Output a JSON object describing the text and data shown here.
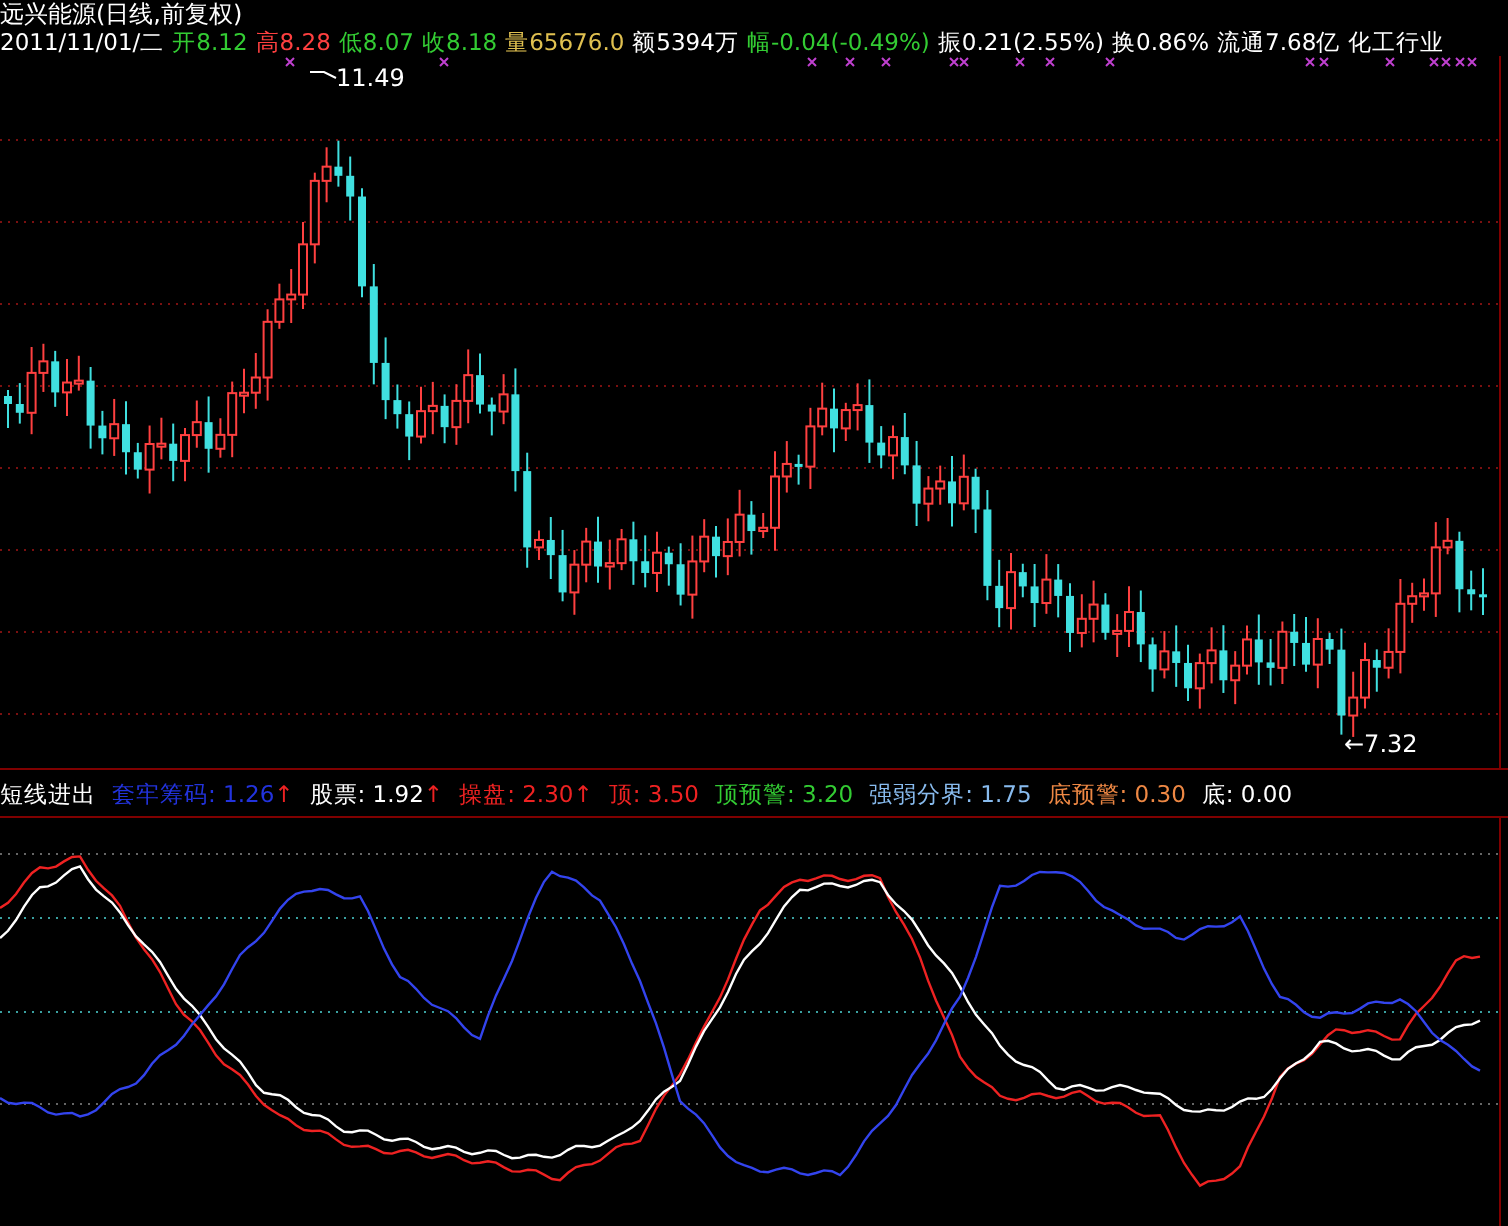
{
  "title": "远兴能源(日线,前复权)",
  "quote": [
    {
      "text": "2011/11/01/二",
      "color": "#ffffff"
    },
    {
      "text": "开8.12",
      "color": "#33cc33"
    },
    {
      "text": "高8.28",
      "color": "#ff4040"
    },
    {
      "text": "低8.07",
      "color": "#33cc33"
    },
    {
      "text": "收8.18",
      "color": "#33cc33"
    },
    {
      "text": "量65676.0",
      "color": "#e0c050"
    },
    {
      "text": "额5394万",
      "color": "#ffffff"
    },
    {
      "text": "幅-0.04(-0.49%)",
      "color": "#33cc33"
    },
    {
      "text": "振0.21(2.55%)",
      "color": "#ffffff"
    },
    {
      "text": "换0.86%",
      "color": "#ffffff"
    },
    {
      "text": "流通7.68亿",
      "color": "#ffffff"
    },
    {
      "text": "化工行业",
      "color": "#ffffff"
    }
  ],
  "main_chart": {
    "high_label": "11.49",
    "low_label": "←7.32"
  },
  "indicator": {
    "items": [
      {
        "text": "短线进出",
        "color": "#ffffff"
      },
      {
        "text": "套牢筹码: 1.26",
        "color": "#2233dd",
        "arrow": "↑"
      },
      {
        "text": "股票: 1.92",
        "color": "#ffffff",
        "arrow": "↑"
      },
      {
        "text": "操盘: 2.30",
        "color": "#ee2222",
        "arrow": "↑"
      },
      {
        "text": "顶: 3.50",
        "color": "#ee2222"
      },
      {
        "text": "顶预警: 3.20",
        "color": "#33cc33"
      },
      {
        "text": "强弱分界: 1.75",
        "color": "#88bbee"
      },
      {
        "text": "底预警: 0.30",
        "color": "#ee8844"
      },
      {
        "text": "底: 0.00",
        "color": "#ffffff"
      }
    ]
  }
}
